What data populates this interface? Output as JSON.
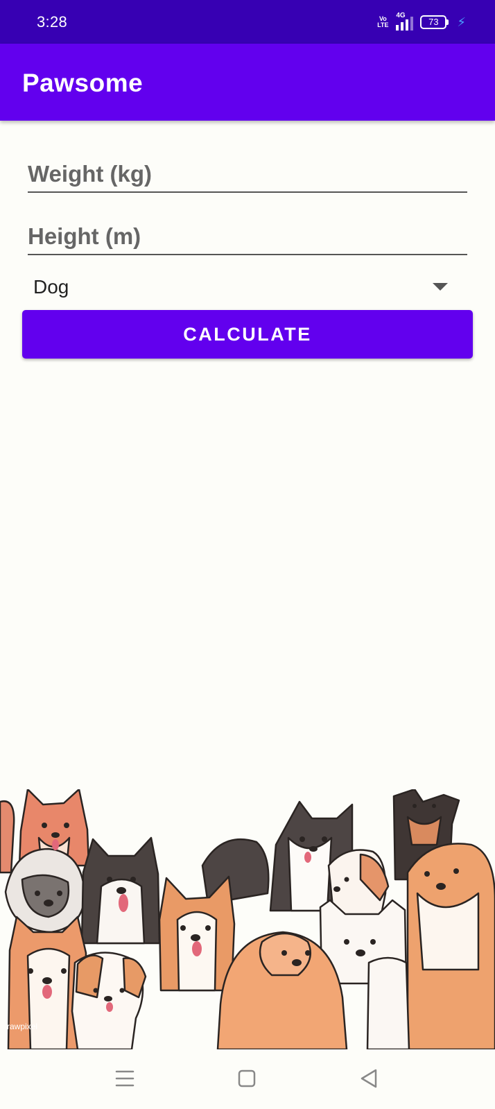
{
  "status_bar": {
    "time": "3:28",
    "volte_line1": "Vo",
    "volte_line2": "LTE",
    "network": "4G",
    "battery": "73",
    "icons": [
      "volte-icon",
      "signal-icon",
      "battery-icon",
      "charging-icon"
    ]
  },
  "app_bar": {
    "title": "Pawsome",
    "color": "#6200ee"
  },
  "form": {
    "weight_placeholder": "Weight (kg)",
    "weight_value": "",
    "height_placeholder": "Height (m)",
    "height_value": "",
    "animal_selected": "Dog",
    "calculate_label": "CALCULATE"
  },
  "illustration": {
    "icon": "dogs-illustration",
    "watermark": "rawpixel"
  },
  "nav": {
    "icons": [
      "menu-icon",
      "home-icon",
      "back-icon"
    ]
  },
  "colors": {
    "status_bar": "#3700b3",
    "primary": "#6200ee",
    "background": "#fdfdf9"
  }
}
